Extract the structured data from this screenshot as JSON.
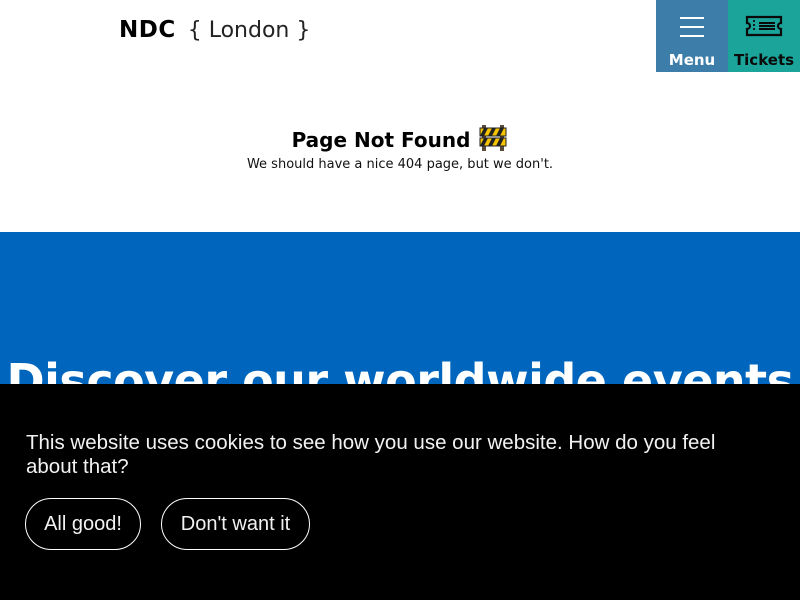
{
  "header": {
    "logo_main": "NDC",
    "logo_city": "{ London }",
    "menu_label": "Menu",
    "tickets_label": "Tickets"
  },
  "not_found": {
    "title": "Page Not Found",
    "subtitle": "We should have a nice 404 page, but we don't.",
    "icon": "construction-barrier-icon"
  },
  "discover": {
    "heading": "Discover our worldwide events"
  },
  "cookie_banner": {
    "message": "This website uses cookies to see how you use our website. How do you feel about that?",
    "accept_label": "All good!",
    "decline_label": "Don't want it"
  },
  "colors": {
    "menu_bg": "#3c7ea9",
    "tickets_bg": "#1ba49a",
    "band_bg": "#0066bd",
    "cookie_bg": "#000000"
  }
}
